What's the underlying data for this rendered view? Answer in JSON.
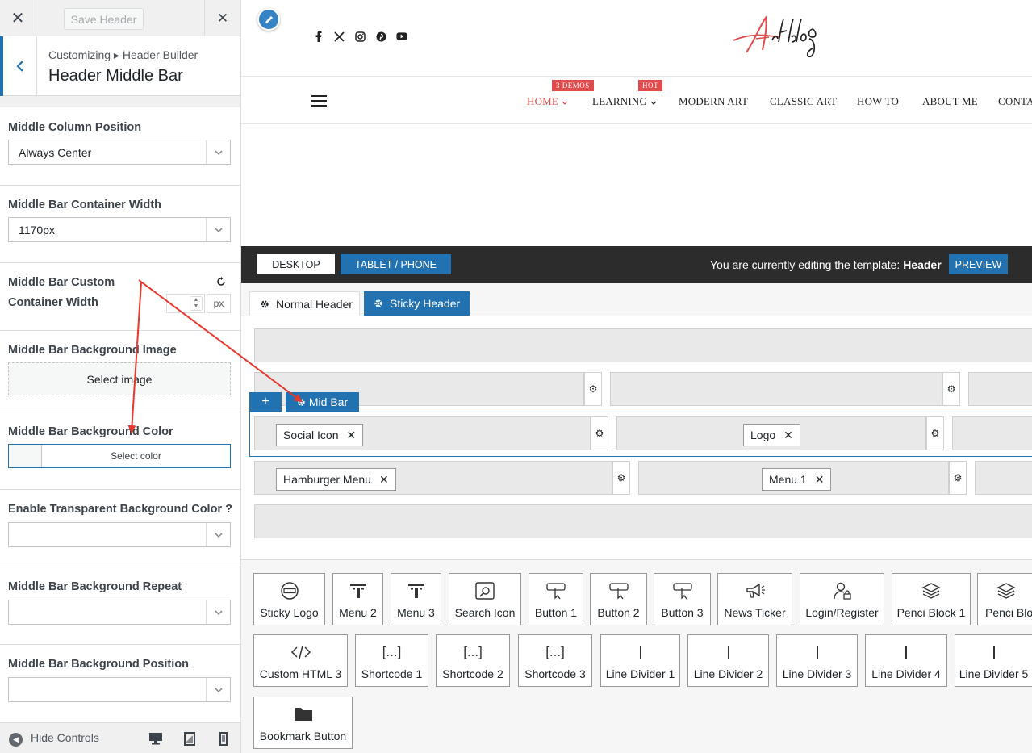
{
  "sidebar": {
    "close_symbol": "✕",
    "save_label": "Save Header",
    "dismiss_symbol": "✕",
    "breadcrumb": "Customizing ▸ Header Builder",
    "title": "Header Middle Bar",
    "controls": {
      "column_position": {
        "label": "Middle Column Position",
        "value": "Always Center"
      },
      "container_width": {
        "label": "Middle Bar Container Width",
        "value": "1170px"
      },
      "custom_width": {
        "label_line1": "Middle Bar Custom",
        "label_line2": "Container Width",
        "unit": "px"
      },
      "bg_image": {
        "label": "Middle Bar Background Image",
        "button": "Select image"
      },
      "bg_color": {
        "label": "Middle Bar Background Color",
        "button": "Select color"
      },
      "transparent": {
        "label": "Enable Transparent Background Color ?"
      },
      "bg_repeat": {
        "label": "Middle Bar Background Repeat"
      },
      "bg_position": {
        "label": "Middle Bar Background Position"
      }
    },
    "footer": {
      "hide_controls": "Hide Controls"
    }
  },
  "site": {
    "logo_text": "Artblog",
    "nav": {
      "home": "HOME",
      "home_badge": "3 DEMOS",
      "learning": "LEARNING",
      "learning_badge": "HOT",
      "modern_art": "MODERN ART",
      "classic_art": "CLASSIC ART",
      "how_to": "HOW TO",
      "about_me": "ABOUT ME",
      "contact": "CONTA"
    },
    "accent_color": "#e24b4b"
  },
  "builder": {
    "desktop_tab": "DESKTOP",
    "tablet_tab": "TABLET / PHONE",
    "editing_prefix": "You are currently editing the template:",
    "editing_template": "Header",
    "preview_button": "PREVIEW",
    "normal_header_tab": "Normal Header",
    "sticky_header_tab": "Sticky Header",
    "mid_bar_label": "Mid Bar",
    "add_symbol": "+",
    "chips": {
      "social_icon": "Social Icon",
      "logo": "Logo",
      "hamburger_menu": "Hamburger Menu",
      "menu_1": "Menu 1"
    },
    "palette": [
      "Sticky Logo",
      "Menu 2",
      "Menu 3",
      "Search Icon",
      "Button 1",
      "Button 2",
      "Button 3",
      "News Ticker",
      "Login/Register",
      "Penci Block 1",
      "Penci Block",
      "Custom HTML 3",
      "Shortcode 1",
      "Shortcode 2",
      "Shortcode 3",
      "Line Divider 1",
      "Line Divider 2",
      "Line Divider 3",
      "Line Divider 4",
      "Line Divider 5",
      "Bookmark Button"
    ],
    "accent_color": "#2271b1"
  }
}
